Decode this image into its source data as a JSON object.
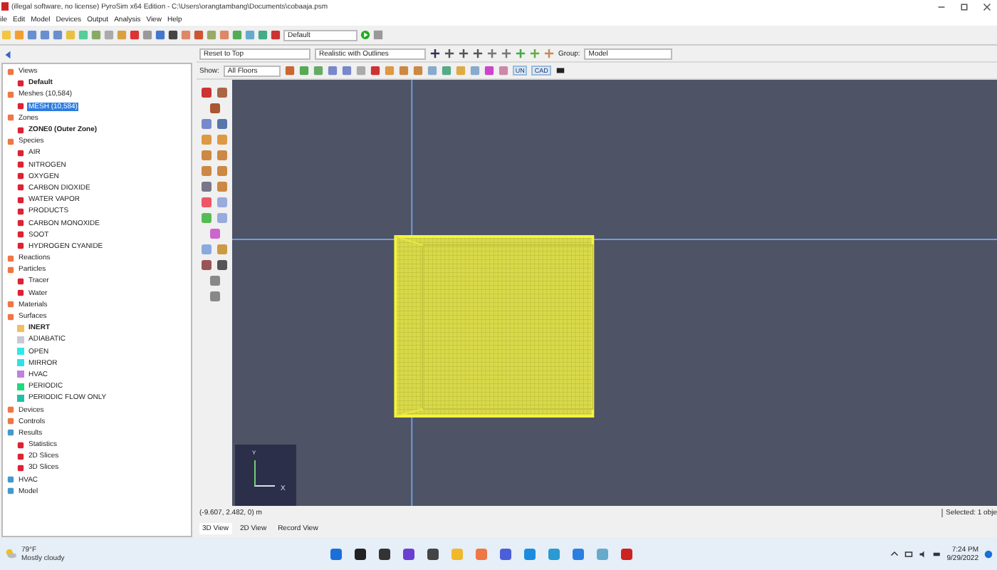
{
  "window": {
    "title": "(illegal software, no license) PyroSim x64 Edition - C:\\Users\\orangtambang\\Documents\\cobaaja.psm"
  },
  "menu": [
    "ile",
    "Edit",
    "Model",
    "Devices",
    "Output",
    "Analysis",
    "View",
    "Help"
  ],
  "toolbar": {
    "view_select": "Default"
  },
  "tree": [
    {
      "label": "Views",
      "selected": false,
      "children": [
        {
          "label": "Default",
          "selected": false,
          "bold": true
        }
      ]
    },
    {
      "label": "Meshes (10,584)",
      "selected": false,
      "children": [
        {
          "label": "MESH (10,584)",
          "selected": true
        }
      ]
    },
    {
      "label": "Zones",
      "selected": false,
      "children": [
        {
          "label": "ZONE0 (Outer Zone)",
          "selected": false,
          "bold": true
        }
      ]
    },
    {
      "label": "Species",
      "selected": false,
      "children": [
        {
          "label": "AIR",
          "selected": false
        },
        {
          "label": "NITROGEN",
          "selected": false
        },
        {
          "label": "OXYGEN",
          "selected": false
        },
        {
          "label": "CARBON DIOXIDE",
          "selected": false
        },
        {
          "label": "WATER VAPOR",
          "selected": false
        },
        {
          "label": "PRODUCTS",
          "selected": false
        },
        {
          "label": "CARBON MONOXIDE",
          "selected": false
        },
        {
          "label": "SOOT",
          "selected": false
        },
        {
          "label": "HYDROGEN CYANIDE",
          "selected": false
        }
      ]
    },
    {
      "label": "Reactions",
      "selected": false
    },
    {
      "label": "Particles",
      "selected": false,
      "children": [
        {
          "label": "Tracer",
          "selected": false
        },
        {
          "label": "Water",
          "selected": false
        }
      ]
    },
    {
      "label": "Materials",
      "selected": false
    },
    {
      "label": "Surfaces",
      "selected": false,
      "children": [
        {
          "label": "INERT",
          "selected": false,
          "bold": true,
          "color": "#f0c060"
        },
        {
          "label": "ADIABATIC",
          "selected": false,
          "color": "#c8c8d8"
        },
        {
          "label": "OPEN",
          "selected": false,
          "color": "#30e8e8"
        },
        {
          "label": "MIRROR",
          "selected": false,
          "color": "#30e0e8"
        },
        {
          "label": "HVAC",
          "selected": false,
          "color": "#c080e0"
        },
        {
          "label": "PERIODIC",
          "selected": false,
          "color": "#20d880"
        },
        {
          "label": "PERIODIC FLOW ONLY",
          "selected": false,
          "color": "#20c0a8"
        }
      ]
    },
    {
      "label": "Devices",
      "selected": false
    },
    {
      "label": "Controls",
      "selected": false
    },
    {
      "label": "Results",
      "selected": false,
      "children": [
        {
          "label": "Statistics",
          "selected": false
        },
        {
          "label": "2D Slices",
          "selected": false
        },
        {
          "label": "3D Slices",
          "selected": false
        }
      ]
    },
    {
      "label": "HVAC",
      "selected": false
    },
    {
      "label": "Model",
      "selected": false
    }
  ],
  "view_toolbar": {
    "camera": "Reset to Top",
    "render_mode": "Realistic with Outlines",
    "group_label": "Group:",
    "group": "Model",
    "show_label": "Show:",
    "floors": "All Floors",
    "toggles": [
      "UN",
      "CAD"
    ]
  },
  "viewport": {
    "axis_x": "X",
    "axis_y": "Y"
  },
  "status": {
    "coordinates": "(-9.607, 2.482, 0) m",
    "selection": "Selected: 1 obje"
  },
  "view_tabs": [
    {
      "label": "3D View",
      "selected": true
    },
    {
      "label": "2D View",
      "selected": false
    },
    {
      "label": "Record View",
      "selected": false
    }
  ],
  "taskbar": {
    "temperature": "79°F",
    "condition": "Mostly cloudy",
    "time": "7:24 PM",
    "date": "9/29/2022"
  }
}
